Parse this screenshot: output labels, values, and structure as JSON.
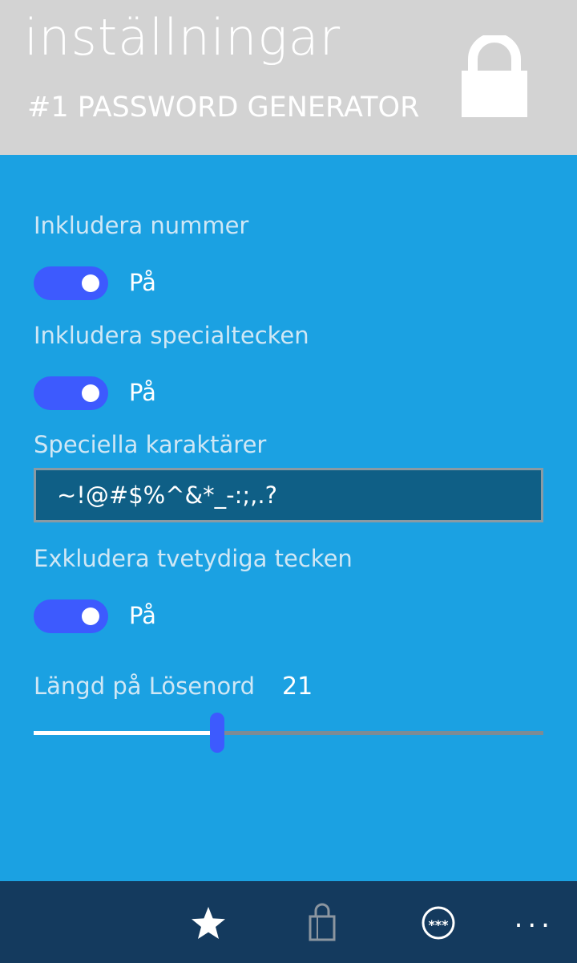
{
  "header": {
    "title": "inställningar",
    "subtitle": "#1 PASSWORD GENERATOR",
    "icon": "lock-icon"
  },
  "settings": {
    "include_numbers": {
      "label": "Inkludera nummer",
      "state": "På",
      "on": true
    },
    "include_special": {
      "label": "Inkludera specialtecken",
      "state": "På",
      "on": true
    },
    "special_chars": {
      "label": "Speciella karaktärer",
      "value": "~!@#$%^&*_-:;,.?"
    },
    "exclude_ambiguous": {
      "label": "Exkludera tvetydiga tecken",
      "state": "På",
      "on": true
    },
    "password_length": {
      "label": "Längd på Lösenord",
      "value": "21",
      "slider_fraction": 0.36
    }
  },
  "appbar": {
    "buttons": [
      {
        "icon": "star-icon"
      },
      {
        "icon": "shopping-bag-icon"
      },
      {
        "icon": "password-dots-icon"
      }
    ],
    "more": "..."
  },
  "colors": {
    "accent": "#1ba1e2",
    "header_bg": "#d3d3d3",
    "toggle_on": "#3d5afe",
    "appbar_bg": "#143a5e",
    "input_bg": "#0f5f86"
  }
}
